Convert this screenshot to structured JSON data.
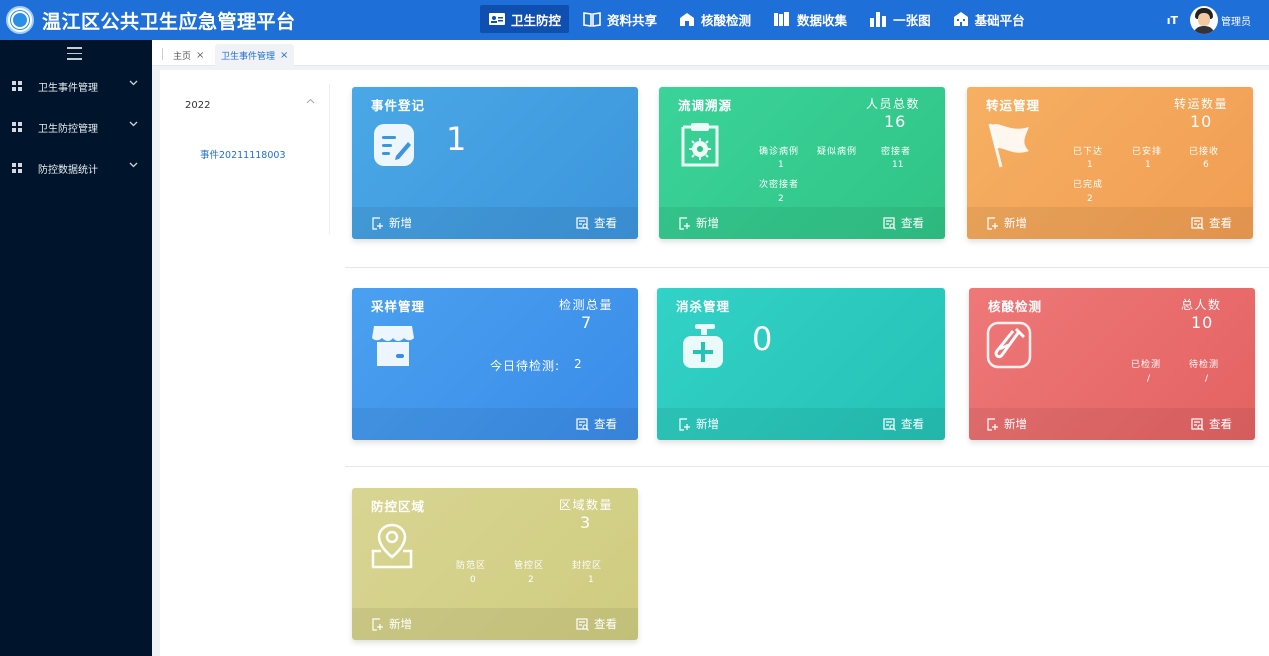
{
  "header": {
    "title": "温江区公共卫生应急管理平台",
    "nav": [
      {
        "label": "卫生防控",
        "icon": "id-card-icon",
        "active": true
      },
      {
        "label": "资料共享",
        "icon": "book-icon",
        "active": false
      },
      {
        "label": "核酸检测",
        "icon": "house-icon",
        "active": false
      },
      {
        "label": "数据收集",
        "icon": "books-icon",
        "active": false
      },
      {
        "label": "一张图",
        "icon": "bar-chart-icon",
        "active": false
      },
      {
        "label": "基础平台",
        "icon": "building-icon",
        "active": false
      }
    ],
    "font_size_icon": "ıT",
    "user_name": "管理员"
  },
  "sidebar": {
    "items": [
      {
        "label": "卫生事件管理"
      },
      {
        "label": "卫生防控管理"
      },
      {
        "label": "防控数据统计"
      }
    ]
  },
  "tabs": [
    {
      "label": "主页",
      "close": "×",
      "active": false
    },
    {
      "label": "卫生事件管理",
      "close": "×",
      "active": true
    }
  ],
  "tree": {
    "year": "2022",
    "event": "事件20211118003"
  },
  "buttons": {
    "add": "新增",
    "view": "查看"
  },
  "cards": {
    "event_register": {
      "title": "事件登记",
      "value": "1",
      "color": "#49a5e3"
    },
    "epi_trace": {
      "title": "流调溯源",
      "total_label": "人员总数",
      "total_value": "16",
      "confirmed_label": "确诊病例",
      "confirmed_value": "1",
      "suspected_label": "疑似病例",
      "suspected_value": "",
      "close_label": "密接者",
      "close_value": "11",
      "sub_close_label": "次密接者",
      "sub_close_value": "2",
      "color": "#36cc8f"
    },
    "transport": {
      "title": "转运管理",
      "total_label": "转运数量",
      "total_value": "10",
      "issued_label": "已下达",
      "issued_value": "1",
      "arranged_label": "已安排",
      "arranged_value": "1",
      "received_label": "已接收",
      "received_value": "6",
      "done_label": "已完成",
      "done_value": "2",
      "color": "#f4a65b"
    },
    "sampling": {
      "title": "采样管理",
      "total_label": "检测总量",
      "total_value": "7",
      "today_label": "今日待检测:",
      "today_value": "2",
      "color": "#3f95ee"
    },
    "disinfection": {
      "title": "消杀管理",
      "value": "0",
      "color": "#2ccbc0"
    },
    "nucleic": {
      "title": "核酸检测",
      "total_label": "总人数",
      "total_value": "10",
      "tested_label": "已检测",
      "tested_value": "/",
      "pending_label": "待检测",
      "pending_value": "/",
      "color": "#ea6d6d"
    },
    "control_area": {
      "title": "防控区域",
      "total_label": "区域数量",
      "total_value": "3",
      "prevent_label": "防范区",
      "prevent_value": "0",
      "manage_label": "管控区",
      "manage_value": "2",
      "seal_label": "封控区",
      "seal_value": "1",
      "color": "#d3d28b"
    }
  }
}
